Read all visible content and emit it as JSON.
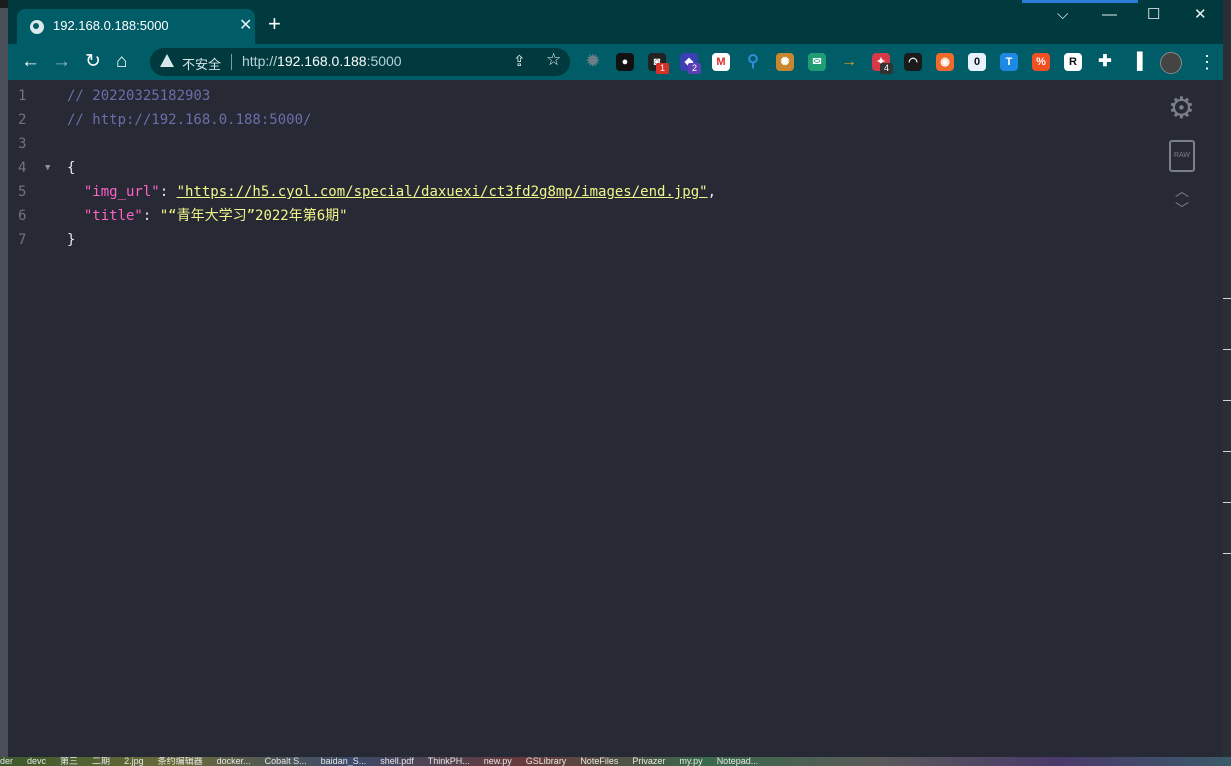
{
  "browser": {
    "tab_title": "192.168.0.188:5000",
    "security_label": "不安全",
    "url_scheme": "http://",
    "url_host": "192.168.0.188",
    "url_port": ":5000",
    "icons": {
      "favicon": "globe-icon",
      "tab_close": "close-icon",
      "new_tab": "plus-icon",
      "back": "arrow-left-icon",
      "forward": "arrow-right-icon",
      "reload": "reload-icon",
      "home": "home-icon",
      "share": "share-icon",
      "bookmark": "star-icon",
      "menu": "three-dots-icon"
    },
    "extensions": [
      {
        "icon": "gear-extension-icon",
        "color": "#6c7f86",
        "badge": ""
      },
      {
        "icon": "ring-extension-icon",
        "color": "#111111",
        "badge": ""
      },
      {
        "icon": "camera-extension-icon",
        "color": "#222222",
        "badge": "1",
        "badge_color": "#d93025"
      },
      {
        "icon": "cube-extension-icon",
        "color": "#3d3fb5",
        "badge": "2",
        "badge_color": "#5b3fb5"
      },
      {
        "icon": "gmail-extension-icon",
        "color": "#ffffff",
        "badge": ""
      },
      {
        "icon": "pin-extension-icon",
        "color": "#2d8fd8",
        "badge": ""
      },
      {
        "icon": "cookie-extension-icon",
        "color": "#c8862e",
        "badge": ""
      },
      {
        "icon": "mail-extension-icon",
        "color": "#1f9d74",
        "badge": ""
      },
      {
        "icon": "arrow-extension-icon",
        "color": "#e39a1a",
        "badge": ""
      },
      {
        "icon": "bell-extension-icon",
        "color": "#d93846",
        "badge": "4",
        "badge_color": "#333333"
      },
      {
        "icon": "hat-extension-icon",
        "color": "#1a1a1a",
        "badge": ""
      },
      {
        "icon": "fox-extension-icon",
        "color": "#f06a2b",
        "badge": ""
      },
      {
        "icon": "counter-extension-icon",
        "color": "#e8f2ff",
        "badge": ""
      },
      {
        "icon": "translate-extension-icon",
        "color": "#1e88e5",
        "badge": ""
      },
      {
        "icon": "percent-extension-icon",
        "color": "#f25022",
        "badge": ""
      },
      {
        "icon": "r-extension-icon",
        "color": "#ffffff",
        "badge": ""
      },
      {
        "icon": "puzzle-extensions-icon",
        "color": "#ffffff",
        "badge": ""
      },
      {
        "icon": "sidebar-icon",
        "color": "#ffffff",
        "badge": ""
      },
      {
        "icon": "avatar",
        "color": "#444444",
        "badge": ""
      }
    ]
  },
  "viewer": {
    "lines": [
      {
        "n": "1",
        "comment": "// 20220325182903"
      },
      {
        "n": "2",
        "comment": "// http://192.168.0.188:5000/"
      },
      {
        "n": "3"
      },
      {
        "n": "4",
        "open": "{"
      },
      {
        "n": "5",
        "key": "\"img_url\"",
        "colon": ": ",
        "value": "\"https://h5.cyol.com/special/daxuexi/ct3fd2g8mp/images/end.jpg\"",
        "comma": ","
      },
      {
        "n": "6",
        "key": "\"title\"",
        "colon": ": ",
        "value": "\"“青年大学习”2022年第6期\""
      },
      {
        "n": "7",
        "close": "}"
      }
    ],
    "raw_label": "RAW",
    "icons": {
      "settings": "gear-icon",
      "raw": "raw-file-icon",
      "collapse": "chevron-up-icon",
      "expand": "chevron-down-icon",
      "fold": "fold-arrow-icon"
    }
  },
  "taskbar": [
    "der",
    "devc",
    "第三",
    "二期",
    "2.jpg",
    "条约编辑器",
    "docker...",
    "Cobalt S...",
    "baidan_S...",
    "shell.pdf",
    "ThinkPH...",
    "new.py",
    "GSLibrary",
    "NoteFiles",
    "Privazer",
    "my.py",
    "Notepad..."
  ]
}
